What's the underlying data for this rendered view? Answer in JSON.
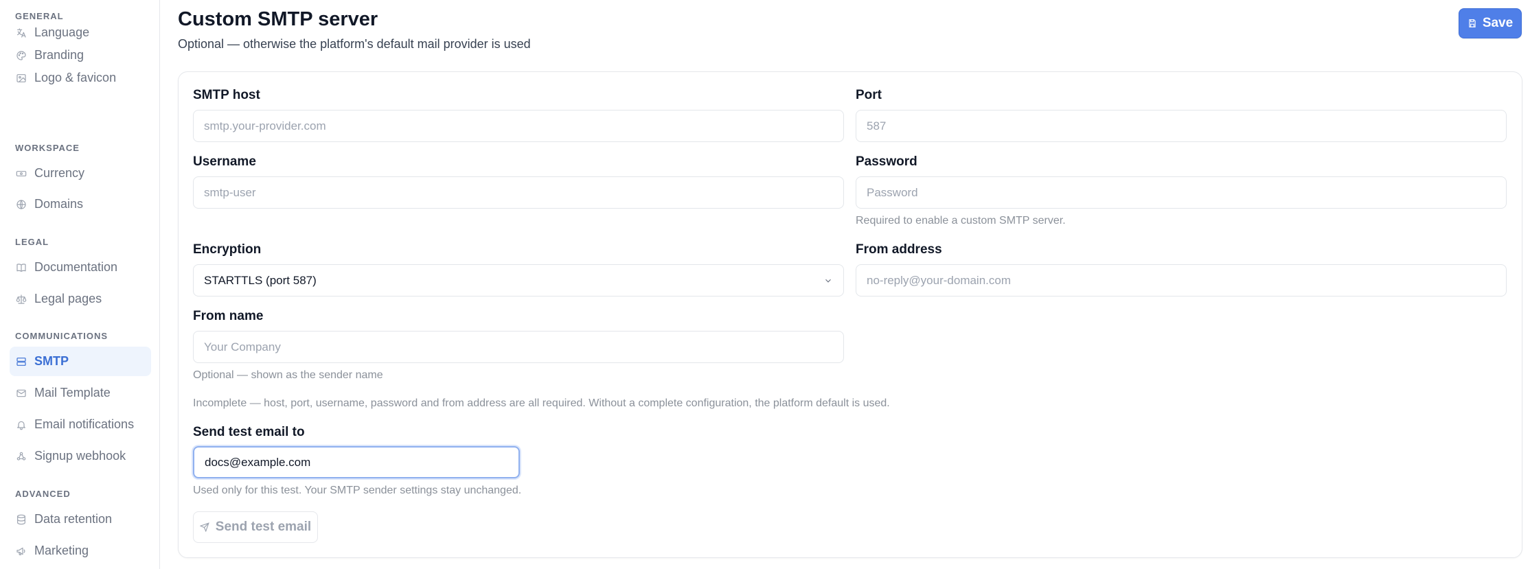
{
  "sidebar": {
    "sections": [
      {
        "title": "GENERAL",
        "items": [
          {
            "label": "Language",
            "icon": "language-icon"
          },
          {
            "label": "Branding",
            "icon": "palette-icon"
          },
          {
            "label": "Logo & favicon",
            "icon": "image-icon"
          }
        ]
      },
      {
        "title": "WORKSPACE",
        "items": [
          {
            "label": "Currency",
            "icon": "banknote-icon"
          },
          {
            "label": "Domains",
            "icon": "globe-icon"
          }
        ]
      },
      {
        "title": "LEGAL",
        "items": [
          {
            "label": "Documentation",
            "icon": "book-icon"
          },
          {
            "label": "Legal pages",
            "icon": "scale-icon"
          }
        ]
      },
      {
        "title": "COMMUNICATIONS",
        "items": [
          {
            "label": "SMTP",
            "icon": "server-icon",
            "active": true
          },
          {
            "label": "Mail Template",
            "icon": "mail-icon"
          },
          {
            "label": "Email notifications",
            "icon": "bell-icon"
          },
          {
            "label": "Signup webhook",
            "icon": "webhook-icon"
          }
        ]
      },
      {
        "title": "ADVANCED",
        "items": [
          {
            "label": "Data retention",
            "icon": "database-icon"
          },
          {
            "label": "Marketing",
            "icon": "megaphone-icon"
          }
        ]
      }
    ]
  },
  "header": {
    "title": "Custom SMTP server",
    "subtitle": "Optional — otherwise the platform's default mail provider is used",
    "save_label": "Save",
    "save_icon": "save-icon"
  },
  "form": {
    "host": {
      "label": "SMTP host",
      "placeholder": "smtp.your-provider.com",
      "value": ""
    },
    "port": {
      "label": "Port",
      "placeholder": "587",
      "value": ""
    },
    "username": {
      "label": "Username",
      "placeholder": "smtp-user",
      "value": ""
    },
    "password": {
      "label": "Password",
      "placeholder": "Password",
      "value": "",
      "help": "Required to enable a custom SMTP server."
    },
    "encryption": {
      "label": "Encryption",
      "value": "STARTTLS (port 587)"
    },
    "from_address": {
      "label": "From address",
      "placeholder": "no-reply@your-domain.com",
      "value": ""
    },
    "from_name": {
      "label": "From name",
      "placeholder": "Your Company",
      "value": "",
      "help": "Optional — shown as the sender name"
    },
    "status_note": "Incomplete — host, port, username, password and from address are all required. Without a complete configuration, the platform default is used.",
    "test": {
      "label": "Send test email to",
      "value": "docs@example.com",
      "help": "Used only for this test. Your SMTP sender settings stay unchanged.",
      "button_label": "Send test email",
      "button_icon": "send-icon"
    }
  },
  "colors": {
    "accent": "#4f7fe8",
    "active_bg": "#eef4fd",
    "active_text": "#3b6fd4"
  }
}
